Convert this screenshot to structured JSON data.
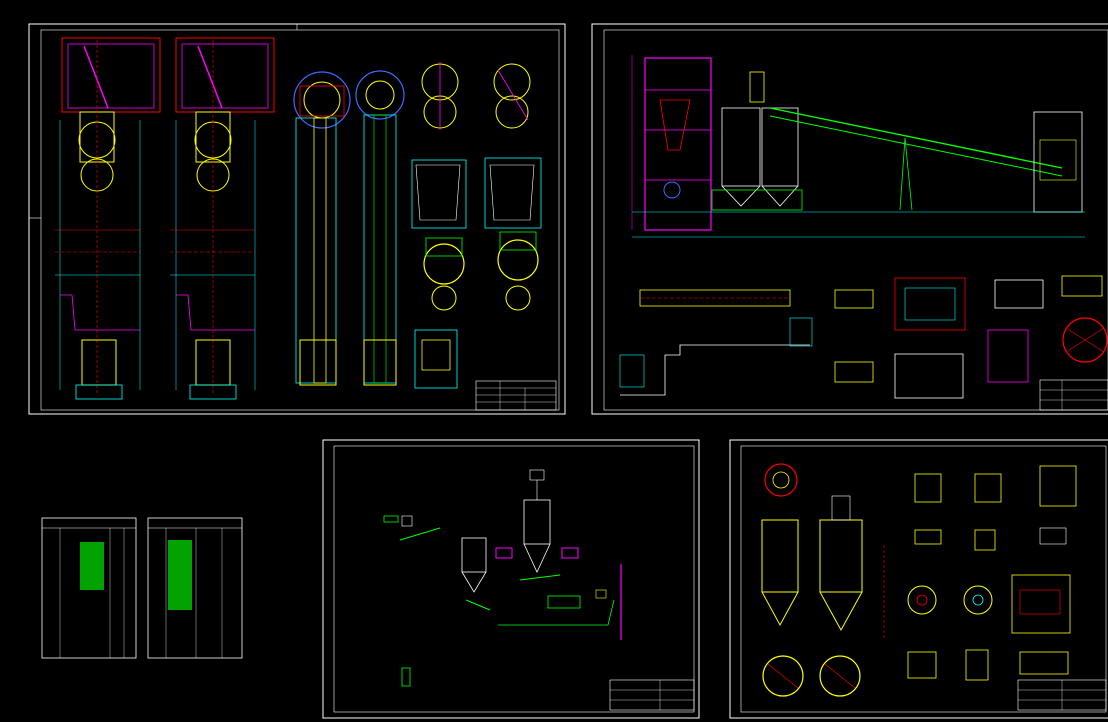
{
  "app": {
    "title": ""
  },
  "colors": {
    "background": "#000000",
    "frame": "#ffffff",
    "cyan": "#00ffff",
    "yellow": "#ffff00",
    "red": "#ff0000",
    "magenta": "#ff00ff",
    "green": "#00ff00",
    "white": "#ffffff",
    "blue": "#3a6bff"
  },
  "sheets": [
    {
      "id": "sheet-elevator-sections",
      "description_icon": "elevator-section-drawing"
    },
    {
      "id": "sheet-plant-elevation",
      "description_icon": "conveyor-plant-elevation-drawing"
    },
    {
      "id": "sheet-process-flow",
      "description_icon": "process-flow-diagram"
    },
    {
      "id": "sheet-silo-details",
      "description_icon": "silo-detail-drawing"
    },
    {
      "id": "sheet-material-list-1",
      "description_icon": "material-table"
    },
    {
      "id": "sheet-material-list-2",
      "description_icon": "material-table"
    }
  ]
}
